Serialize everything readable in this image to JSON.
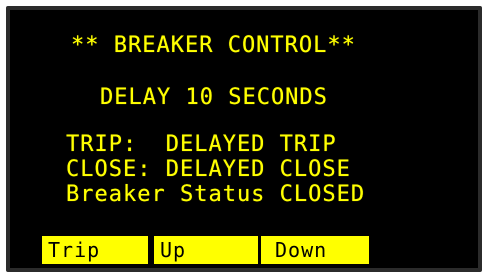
{
  "screen": {
    "title": "** BREAKER CONTROL**",
    "delay": "DELAY 10 SECONDS",
    "trip": "TRIP:  DELAYED TRIP",
    "close": "CLOSE: DELAYED CLOSE",
    "status": "Breaker Status CLOSED"
  },
  "softkeys": {
    "trip": "Trip",
    "up": "Up",
    "down": "Down"
  },
  "colors": {
    "background": "#000000",
    "text": "#ffff00",
    "softkey_bg": "#ffff00",
    "softkey_text": "#000000"
  }
}
